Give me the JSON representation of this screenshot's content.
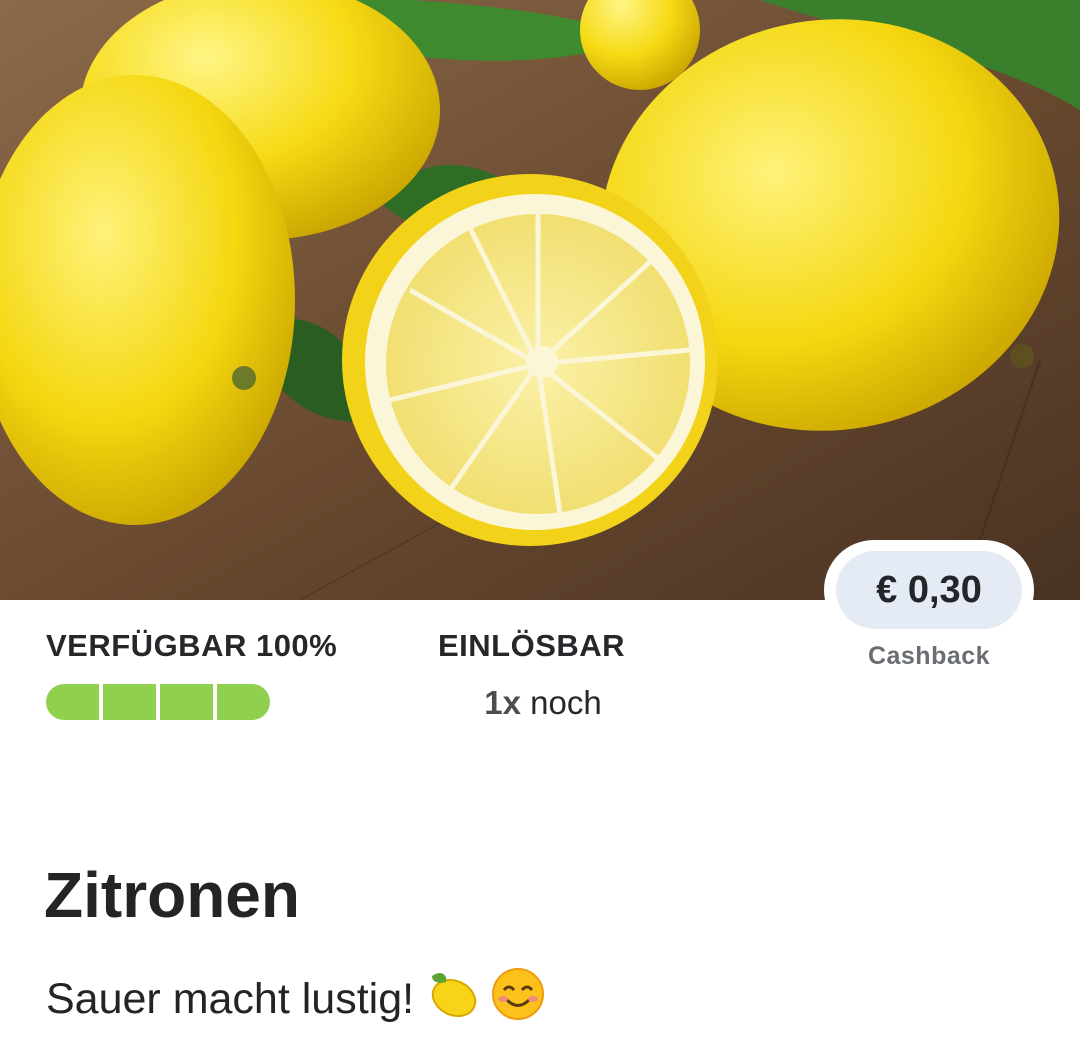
{
  "product": {
    "title": "Zitronen",
    "subtitle": "Sauer macht lustig!",
    "subtitle_emojis": [
      "lemon-emoji",
      "smiling-face-emoji"
    ],
    "image_icon": "lemons-photo"
  },
  "price": {
    "value": "€ 0,30",
    "label": "Cashback"
  },
  "availability": {
    "label": "VERFÜGBAR 100%",
    "fraction": 1.0,
    "segments": 4,
    "color": "#8fd14f"
  },
  "redeem": {
    "label": "EINLÖSBAR",
    "count": "1x",
    "suffix": "noch"
  }
}
